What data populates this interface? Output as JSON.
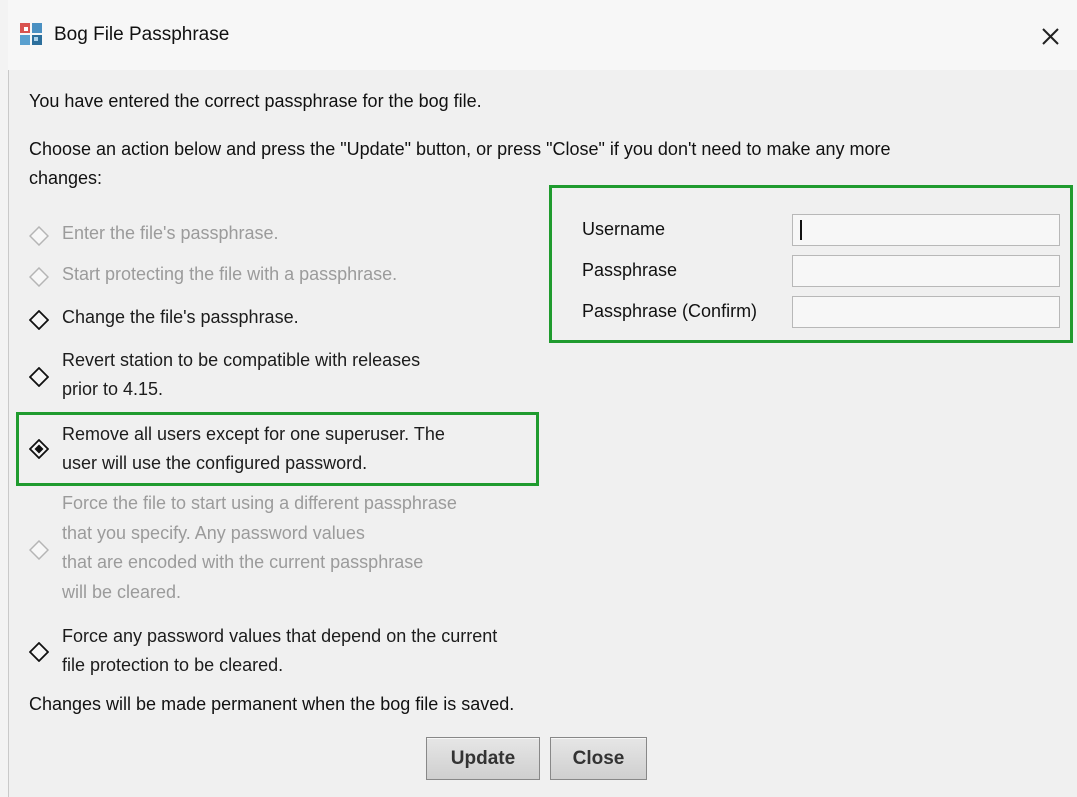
{
  "dialog": {
    "title": "Bog File Passphrase",
    "intro": "You have entered the correct passphrase for the bog file.",
    "instructions_line1": "Choose an action below and press the \"Update\" button, or press \"Close\" if you don't need to make any more",
    "instructions_line2": "changes:",
    "footer_note": "Changes will be made permanent when the bog file is saved."
  },
  "options": [
    {
      "lines": [
        "Enter the file's passphrase."
      ],
      "enabled": false,
      "selected": false
    },
    {
      "lines": [
        "Start protecting the file with a passphrase."
      ],
      "enabled": false,
      "selected": false
    },
    {
      "lines": [
        "Change the file's passphrase."
      ],
      "enabled": true,
      "selected": false
    },
    {
      "lines": [
        "Revert station to be compatible with releases",
        "prior to 4.15."
      ],
      "enabled": true,
      "selected": false
    },
    {
      "lines": [
        "Remove all users except for one superuser. The",
        "user will use the configured password."
      ],
      "enabled": true,
      "selected": true
    },
    {
      "lines": [
        "Force the file to start using a different passphrase",
        "that you specify. Any password values",
        "that are encoded with the current passphrase",
        "will be cleared."
      ],
      "enabled": false,
      "selected": false
    },
    {
      "lines": [
        "Force any password values that depend on the current",
        "file protection to be cleared."
      ],
      "enabled": true,
      "selected": false
    }
  ],
  "fields": {
    "username": {
      "label": "Username",
      "value": ""
    },
    "passphrase": {
      "label": "Passphrase",
      "value": ""
    },
    "passphrase_confirm": {
      "label": "Passphrase (Confirm)",
      "value": ""
    }
  },
  "buttons": {
    "update": "Update",
    "close": "Close"
  },
  "colors": {
    "highlight": "#1f9b2e",
    "disabled_text": "#9b9b9b"
  }
}
